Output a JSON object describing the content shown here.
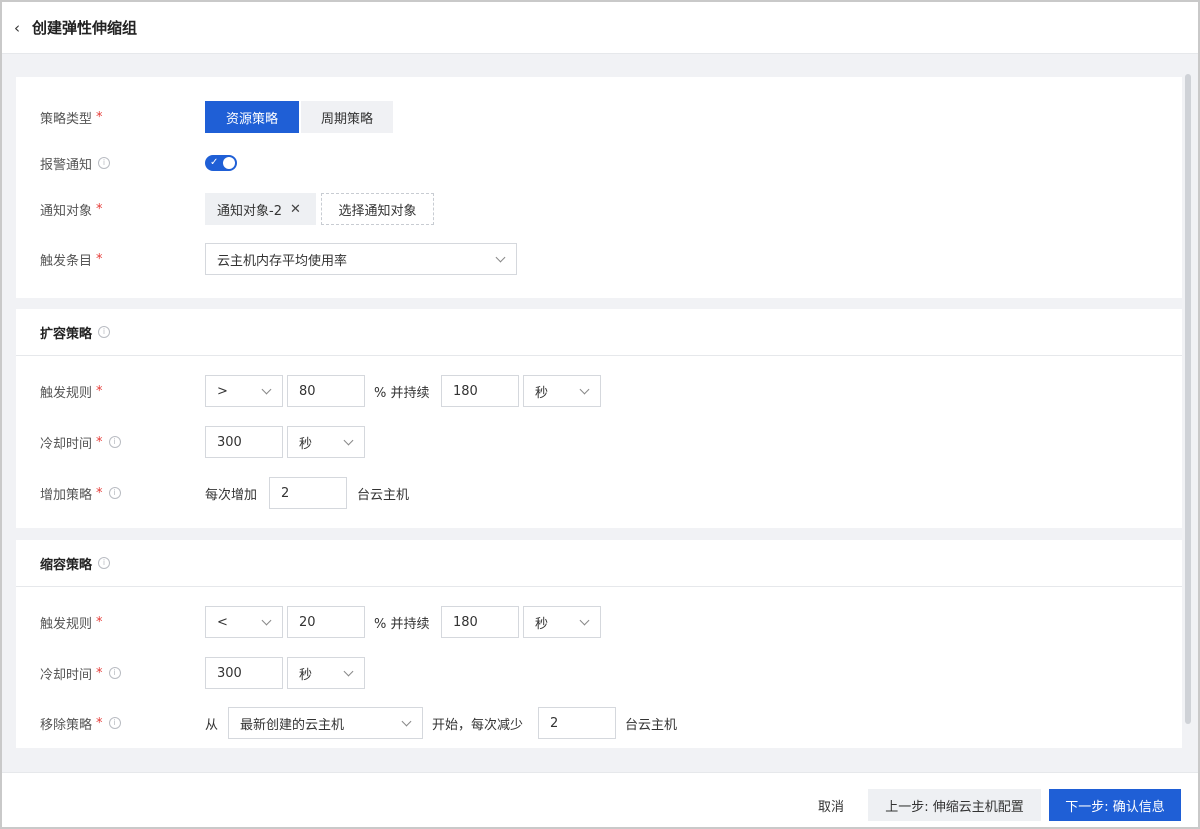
{
  "header": {
    "back_icon": "chevron-left-icon",
    "title": "创建弹性伸缩组"
  },
  "basic": {
    "strategy_type": {
      "label": "策略类型",
      "options": [
        "资源策略",
        "周期策略"
      ],
      "selected": "资源策略"
    },
    "alert_notify": {
      "label": "报警通知",
      "enabled": true
    },
    "notify_target": {
      "label": "通知对象",
      "tags": [
        "通知对象-2"
      ],
      "select_label": "选择通知对象"
    },
    "trigger_item": {
      "label": "触发条目",
      "value": "云主机内存平均使用率"
    }
  },
  "scale_out": {
    "title": "扩容策略",
    "trigger_rule": {
      "label": "触发规则",
      "operator": ">",
      "threshold": "80",
      "unit_text": "% 并持续",
      "duration": "180",
      "duration_unit": "秒"
    },
    "cooldown": {
      "label": "冷却时间",
      "value": "300",
      "unit": "秒"
    },
    "add_policy": {
      "label": "增加策略",
      "prefix": "每次增加",
      "value": "2",
      "suffix": "台云主机"
    }
  },
  "scale_in": {
    "title": "缩容策略",
    "trigger_rule": {
      "label": "触发规则",
      "operator": "<",
      "threshold": "20",
      "unit_text": "% 并持续",
      "duration": "180",
      "duration_unit": "秒"
    },
    "cooldown": {
      "label": "冷却时间",
      "value": "300",
      "unit": "秒"
    },
    "remove_policy": {
      "label": "移除策略",
      "prefix": "从",
      "source": "最新创建的云主机",
      "middle": "开始，每次减少",
      "value": "2",
      "suffix": "台云主机"
    }
  },
  "footer": {
    "cancel": "取消",
    "prev": "上一步: 伸缩云主机配置",
    "next": "下一步: 确认信息"
  },
  "colors": {
    "primary": "#1f5fd6",
    "required": "#e53935"
  }
}
